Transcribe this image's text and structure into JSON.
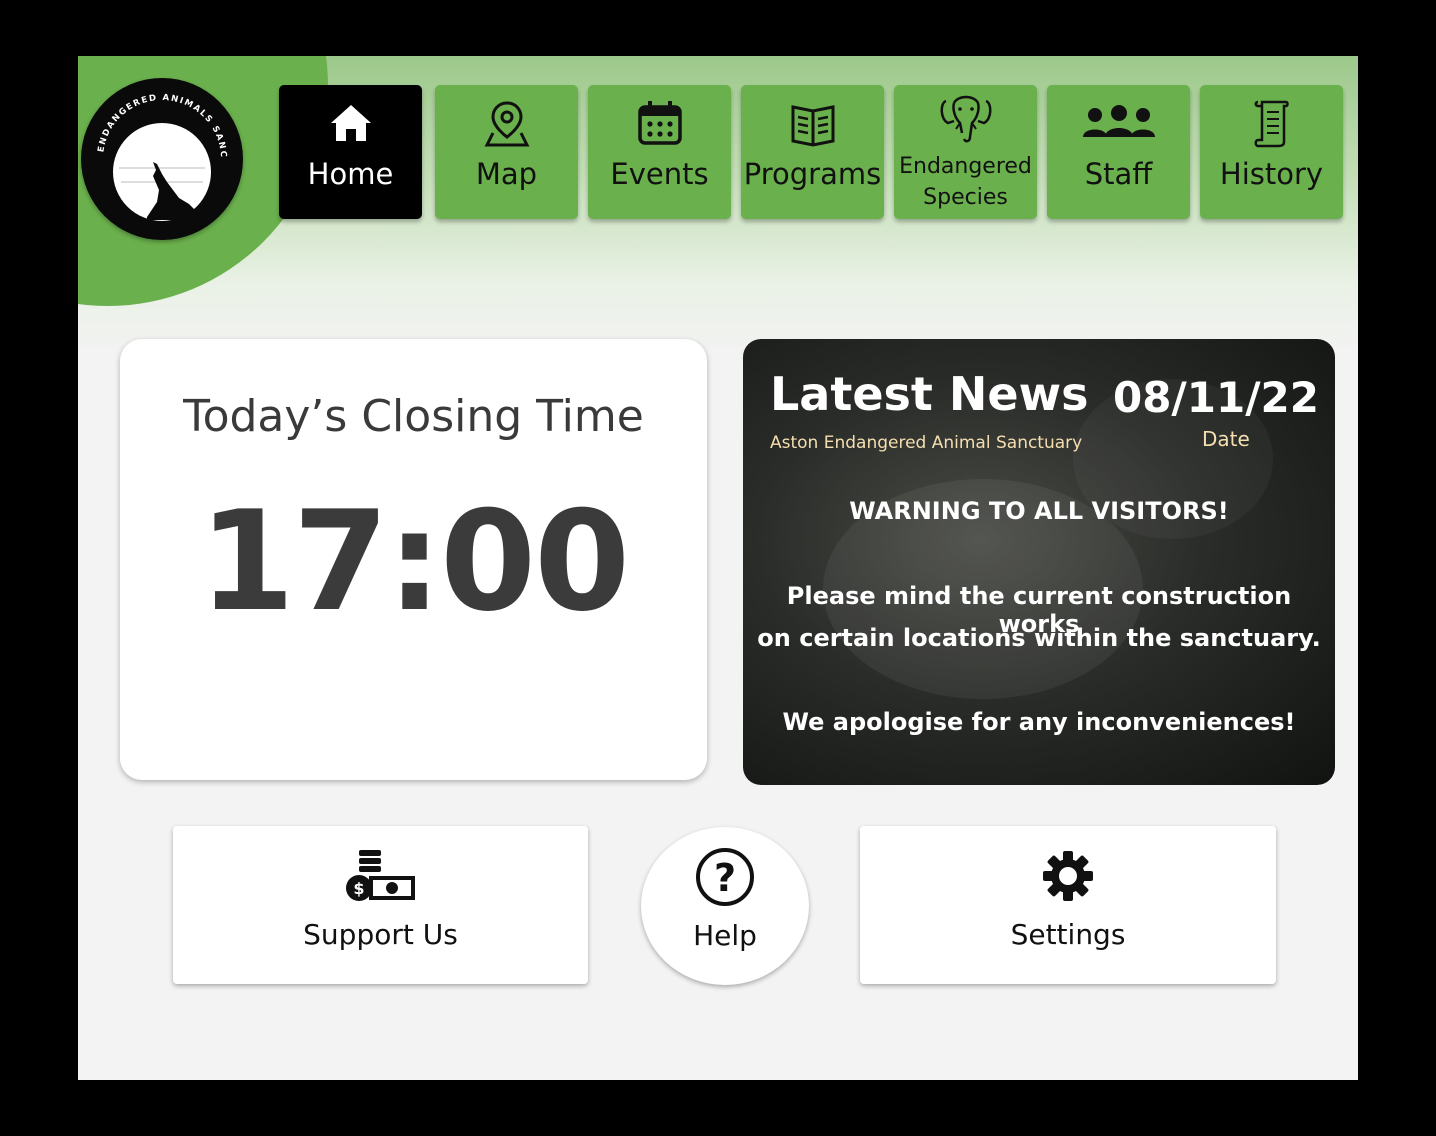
{
  "logo": {
    "text": "ASTON ENDANGERED ANIMALS SANCTUARY"
  },
  "nav": {
    "items": [
      {
        "label": "Home",
        "icon": "home-icon",
        "active": true
      },
      {
        "label": "Map",
        "icon": "map-pin-icon",
        "active": false
      },
      {
        "label": "Events",
        "icon": "calendar-icon",
        "active": false
      },
      {
        "label": "Programs",
        "icon": "book-icon",
        "active": false
      },
      {
        "label_line1": "Endangered",
        "label_line2": "Species",
        "icon": "elephant-icon",
        "active": false
      },
      {
        "label": "Staff",
        "icon": "people-icon",
        "active": false
      },
      {
        "label": "History",
        "icon": "scroll-icon",
        "active": false
      }
    ]
  },
  "closing": {
    "title": "Today’s Closing Time",
    "time": "17:00"
  },
  "news": {
    "title": "Latest News",
    "subtitle": "Aston Endangered Animal Sanctuary",
    "date": "08/11/22",
    "date_label": "Date",
    "warning": "WARNING TO ALL VISITORS!",
    "message_line1": "Please mind the current construction works",
    "message_line2": "on certain locations within the sanctuary.",
    "apology": "We apologise for any inconveniences!"
  },
  "actions": {
    "support_label": "Support Us",
    "help_label": "Help",
    "settings_label": "Settings"
  },
  "colors": {
    "nav_green": "#6ab04c",
    "active_black": "#000000",
    "background": "#f3f3f3",
    "news_accent": "#f5dfb0"
  }
}
